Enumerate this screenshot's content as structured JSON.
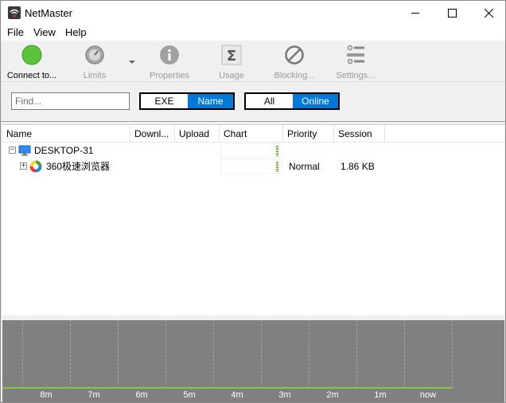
{
  "app": {
    "title": "NetMaster"
  },
  "menu": {
    "file": "File",
    "view": "View",
    "help": "Help"
  },
  "toolbar": {
    "connect": "Connect to...",
    "limits": "Limits",
    "properties": "Properties",
    "usage": "Usage",
    "blocking": "Blocking...",
    "settings": "Settings..."
  },
  "filter": {
    "find_placeholder": "Find...",
    "exe": "EXE",
    "name": "Name",
    "all": "All",
    "online": "Online"
  },
  "columns": {
    "name": "Name",
    "download": "Downl...",
    "upload": "Upload",
    "chart": "Chart",
    "priority": "Priority",
    "session": "Session"
  },
  "rows": [
    {
      "name": "DESKTOP-31",
      "download": "",
      "upload": "",
      "priority": "",
      "session": ""
    },
    {
      "name": "360极速浏览器",
      "download": "",
      "upload": "",
      "priority": "Normal",
      "session": "1.86 KB"
    }
  ],
  "graph": {
    "time_labels": [
      "8m",
      "7m",
      "6m",
      "5m",
      "4m",
      "3m",
      "2m",
      "1m",
      "now"
    ]
  },
  "colors": {
    "accent": "#0078d7",
    "connect_green": "#5cc33a",
    "graph_bg": "#808080",
    "graph_line": "#8bc34a"
  }
}
